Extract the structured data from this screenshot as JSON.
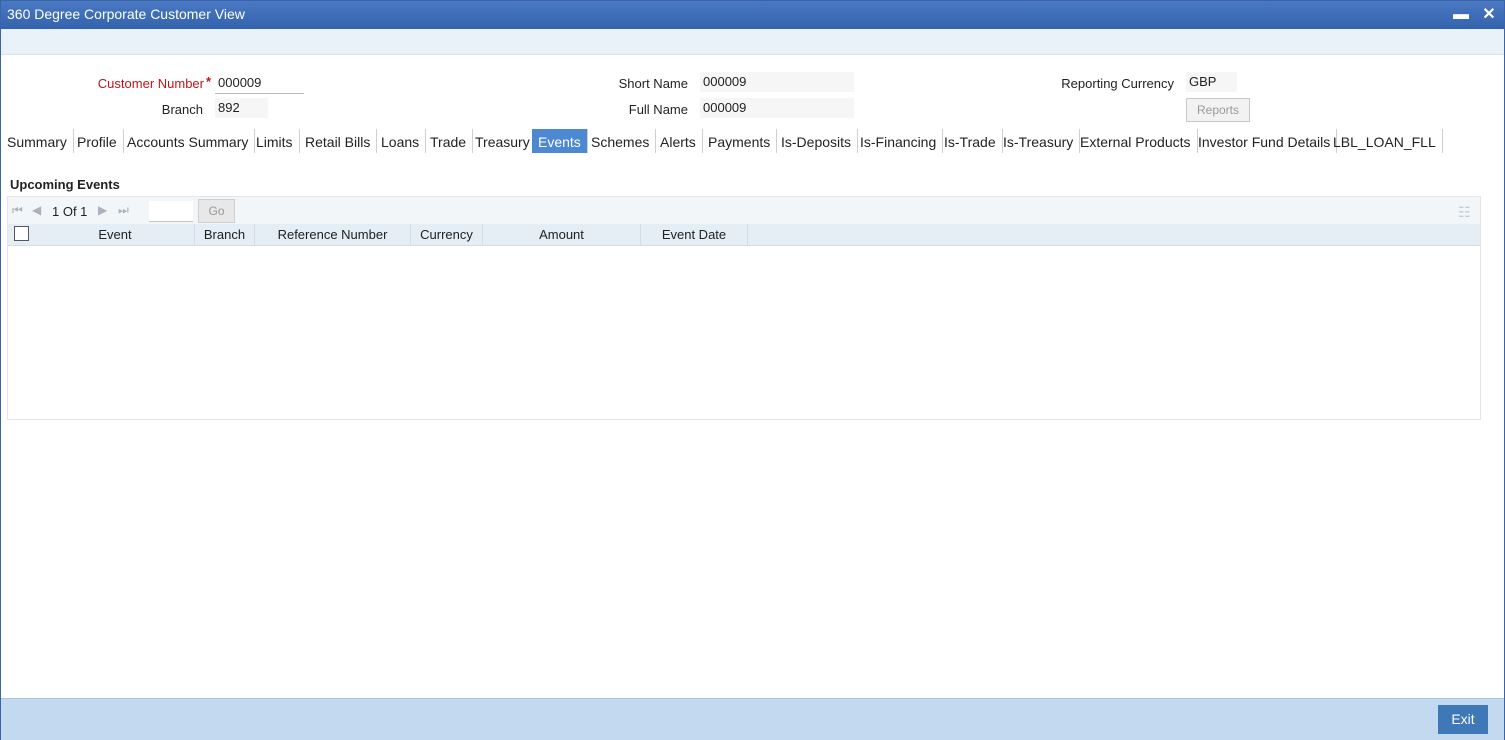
{
  "window": {
    "title": "360 Degree Corporate Customer View",
    "minimize_glyph": "▬",
    "close_glyph": "✕"
  },
  "header": {
    "customer_number": {
      "label": "Customer Number",
      "required_mark": "*",
      "value": "000009"
    },
    "branch": {
      "label": "Branch",
      "value": "892"
    },
    "short_name": {
      "label": "Short Name",
      "value": "000009"
    },
    "full_name": {
      "label": "Full Name",
      "value": "000009"
    },
    "reporting_currency": {
      "label": "Reporting Currency",
      "value": "GBP"
    },
    "reports_button": "Reports"
  },
  "tabs": [
    "Summary",
    "Profile",
    "Accounts Summary",
    "Limits",
    "Retail Bills",
    "Loans",
    "Trade",
    "Treasury",
    "Events",
    "Schemes",
    "Alerts",
    "Payments",
    "Is-Deposits",
    "Is-Financing",
    "Is-Trade",
    "Is-Treasury",
    "External Products",
    "Investor Fund Details",
    "LBL_LOAN_FLL"
  ],
  "active_tab": "Events",
  "upcoming_events": {
    "title": "Upcoming Events",
    "pager": {
      "text": "1 Of 1",
      "go_label": "Go"
    },
    "columns": [
      "Event",
      "Branch",
      "Reference Number",
      "Currency",
      "Amount",
      "Event Date"
    ],
    "rows": []
  },
  "footer": {
    "exit_label": "Exit"
  },
  "colors": {
    "title_bar": "#3a6cb7",
    "active_tab": "#4d88d3",
    "footer": "#c3d9ef",
    "required": "#c0141b"
  }
}
